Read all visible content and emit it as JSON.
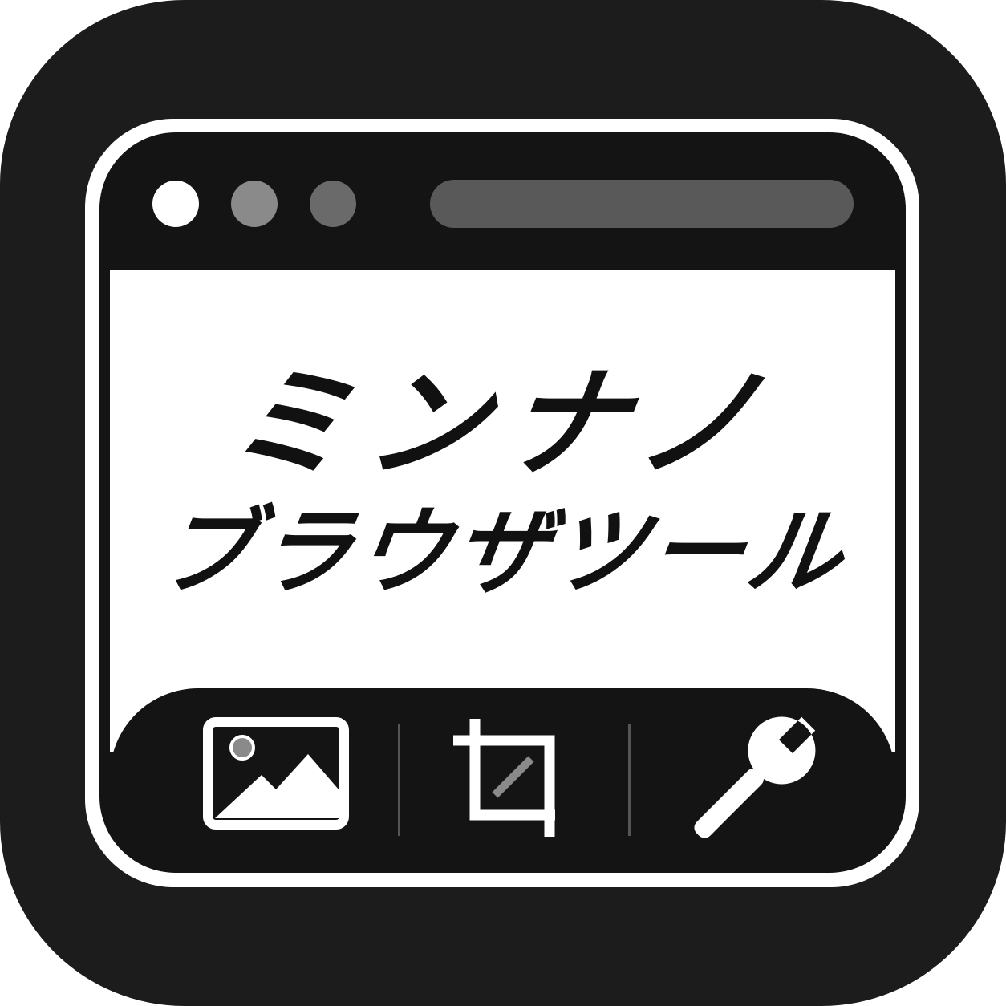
{
  "title": {
    "line1": "ミンナノ",
    "line2": "ブラウザツール"
  },
  "window_controls": [
    "close-dot",
    "minimize-dot",
    "maximize-dot"
  ],
  "toolbar": {
    "tools": [
      {
        "icon": "image-icon"
      },
      {
        "icon": "crop-icon"
      },
      {
        "icon": "wrench-icon"
      }
    ]
  },
  "colors": {
    "icon_background": "#1c1c1c",
    "window_border": "#ffffff",
    "window_frame": "#141414",
    "content_background": "#ffffff",
    "text": "#111111",
    "address_bar": "#595959"
  }
}
